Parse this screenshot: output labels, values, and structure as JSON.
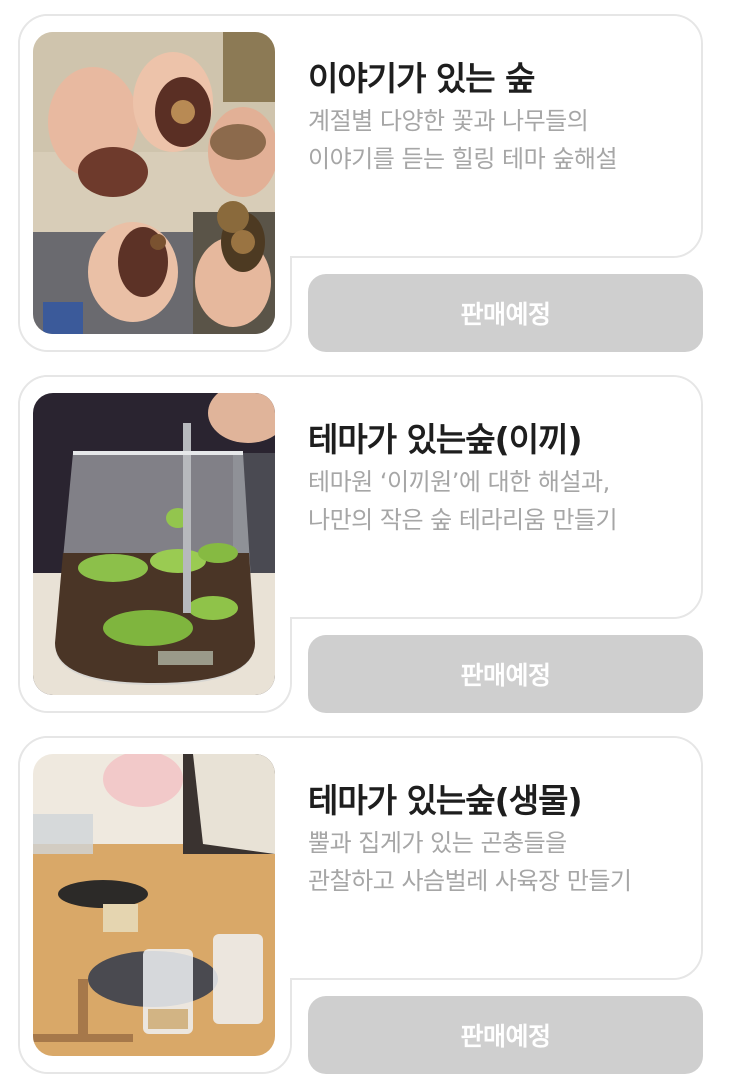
{
  "programs": [
    {
      "title": "이야기가 있는 숲",
      "desc_line1": "계절별 다양한 꽃과 나무들의",
      "desc_line2": "이야기를 듣는 힐링 테마 숲해설",
      "button_label": "판매예정",
      "photo": "hands-holding-leaves-and-acorns-photo"
    },
    {
      "title": "테마가 있는숲(이끼)",
      "desc_line1": "테마원 ‘이끼원’에 대한 해설과,",
      "desc_line2": "나만의 작은 숲 테라리움 만들기",
      "button_label": "판매예정",
      "photo": "moss-terrarium-glass-vase-photo"
    },
    {
      "title": "테마가 있는숲(생물)",
      "desc_line1": "뿔과 집게가 있는 곤충들을",
      "desc_line2": "관찰하고 사슴벌레 사육장 만들기",
      "button_label": "판매예정",
      "photo": "insect-habitat-workshop-table-photo"
    }
  ]
}
